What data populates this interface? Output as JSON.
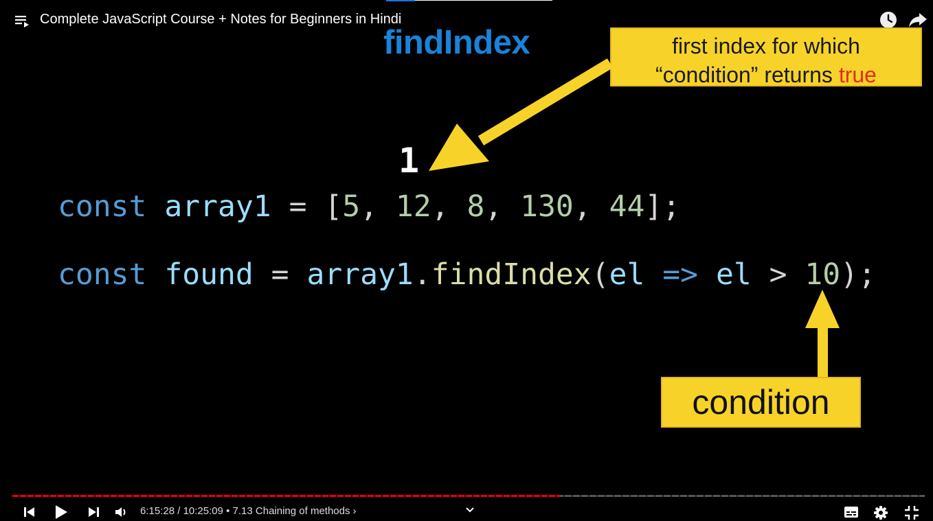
{
  "video": {
    "title": "Complete JavaScript Course + Notes for Beginners in Hindi"
  },
  "slide": {
    "heading": "findIndex",
    "callout_line1": "first index for which",
    "callout_line2_pre": "“condition” returns ",
    "callout_line2_highlight": "true",
    "result": "1",
    "code_line1": [
      {
        "t": "const",
        "c": "kw"
      },
      {
        "t": " ",
        "c": "op"
      },
      {
        "t": "array1",
        "c": "id"
      },
      {
        "t": " = [",
        "c": "op"
      },
      {
        "t": "5",
        "c": "num"
      },
      {
        "t": ", ",
        "c": "op"
      },
      {
        "t": "12",
        "c": "num"
      },
      {
        "t": ", ",
        "c": "op"
      },
      {
        "t": "8",
        "c": "num"
      },
      {
        "t": ", ",
        "c": "op"
      },
      {
        "t": "130",
        "c": "num"
      },
      {
        "t": ", ",
        "c": "op"
      },
      {
        "t": "44",
        "c": "num"
      },
      {
        "t": "];",
        "c": "op"
      }
    ],
    "code_line2": [
      {
        "t": "const",
        "c": "kw"
      },
      {
        "t": " ",
        "c": "op"
      },
      {
        "t": "found",
        "c": "id"
      },
      {
        "t": " = ",
        "c": "op"
      },
      {
        "t": "array1",
        "c": "id"
      },
      {
        "t": ".",
        "c": "op"
      },
      {
        "t": "findIndex",
        "c": "fn"
      },
      {
        "t": "(",
        "c": "op"
      },
      {
        "t": "el",
        "c": "id"
      },
      {
        "t": " ",
        "c": "op"
      },
      {
        "t": "=>",
        "c": "kw"
      },
      {
        "t": " ",
        "c": "op"
      },
      {
        "t": "el",
        "c": "id"
      },
      {
        "t": " > ",
        "c": "op"
      },
      {
        "t": "10",
        "c": "num"
      },
      {
        "t": ");",
        "c": "op"
      }
    ],
    "condition_label": "condition"
  },
  "controls": {
    "current_time": "6:15:28",
    "duration": "10:25:09",
    "time_separator": " / ",
    "chapter_separator": " • ",
    "chapter": "7.13 Chaining of methods",
    "chapter_chevron": "›",
    "progress_fraction": 0.6
  },
  "colors": {
    "accent_red": "#e00000",
    "callout_yellow": "#f7d32a",
    "heading_blue": "#1a82d9"
  },
  "icons": [
    "playlist-icon",
    "watch-later-icon",
    "share-icon",
    "previous-icon",
    "play-icon",
    "next-icon",
    "volume-icon",
    "chevron-down-icon",
    "subtitles-icon",
    "settings-icon",
    "fullscreen-exit-icon"
  ]
}
